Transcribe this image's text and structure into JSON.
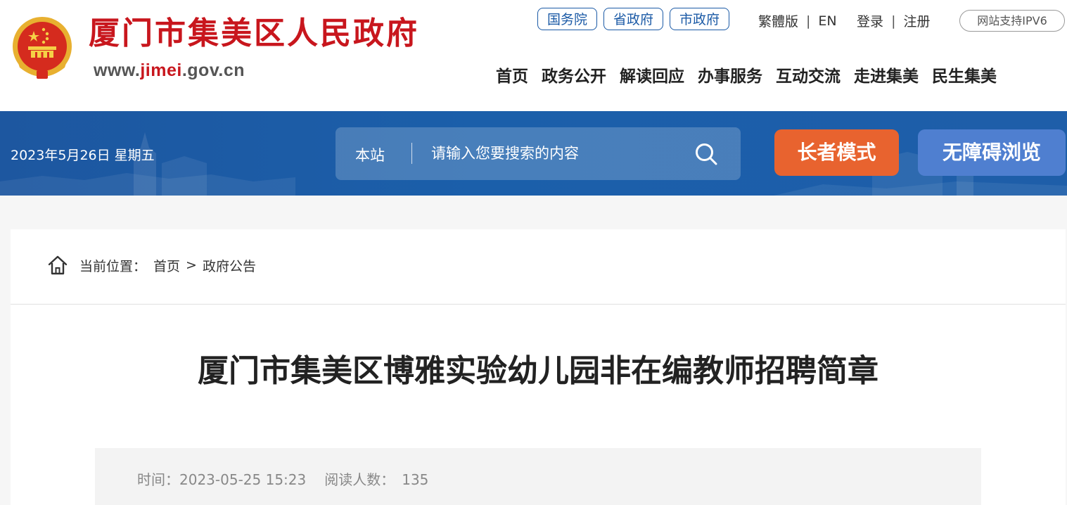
{
  "header": {
    "site_name": "厦门市集美区人民政府",
    "url_prefix": "www.",
    "url_highlight": "jimei",
    "url_suffix": ".gov.cn",
    "gov_links": [
      "国务院",
      "省政府",
      "市政府"
    ],
    "traditional": "繁體版",
    "english": "EN",
    "login": "登录",
    "register": "注册",
    "ipv6": "网站支持IPV6",
    "nav": [
      "首页",
      "政务公开",
      "解读回应",
      "办事服务",
      "互动交流",
      "走进集美",
      "民生集美"
    ]
  },
  "banner": {
    "date": "2023年5月26日 星期五",
    "search_scope": "本站",
    "search_placeholder": "请输入您要搜索的内容",
    "elder_mode": "长者模式",
    "accessibility": "无障碍浏览"
  },
  "breadcrumb": {
    "label": "当前位置：",
    "home": "首页",
    "separator": ">",
    "current": "政府公告"
  },
  "article": {
    "title": "厦门市集美区博雅实验幼儿园非在编教师招聘简章",
    "time_label": "时间：",
    "time_value": "2023-05-25 15:23",
    "views_label": "阅读人数：",
    "views_value": "135"
  },
  "colors": {
    "brand_red": "#c8161d",
    "banner_blue": "#1b5faa",
    "elder_orange": "#e8632f",
    "access_blue": "#4f7fd0"
  },
  "icons": [
    "national-emblem-icon",
    "search-icon",
    "home-icon"
  ]
}
